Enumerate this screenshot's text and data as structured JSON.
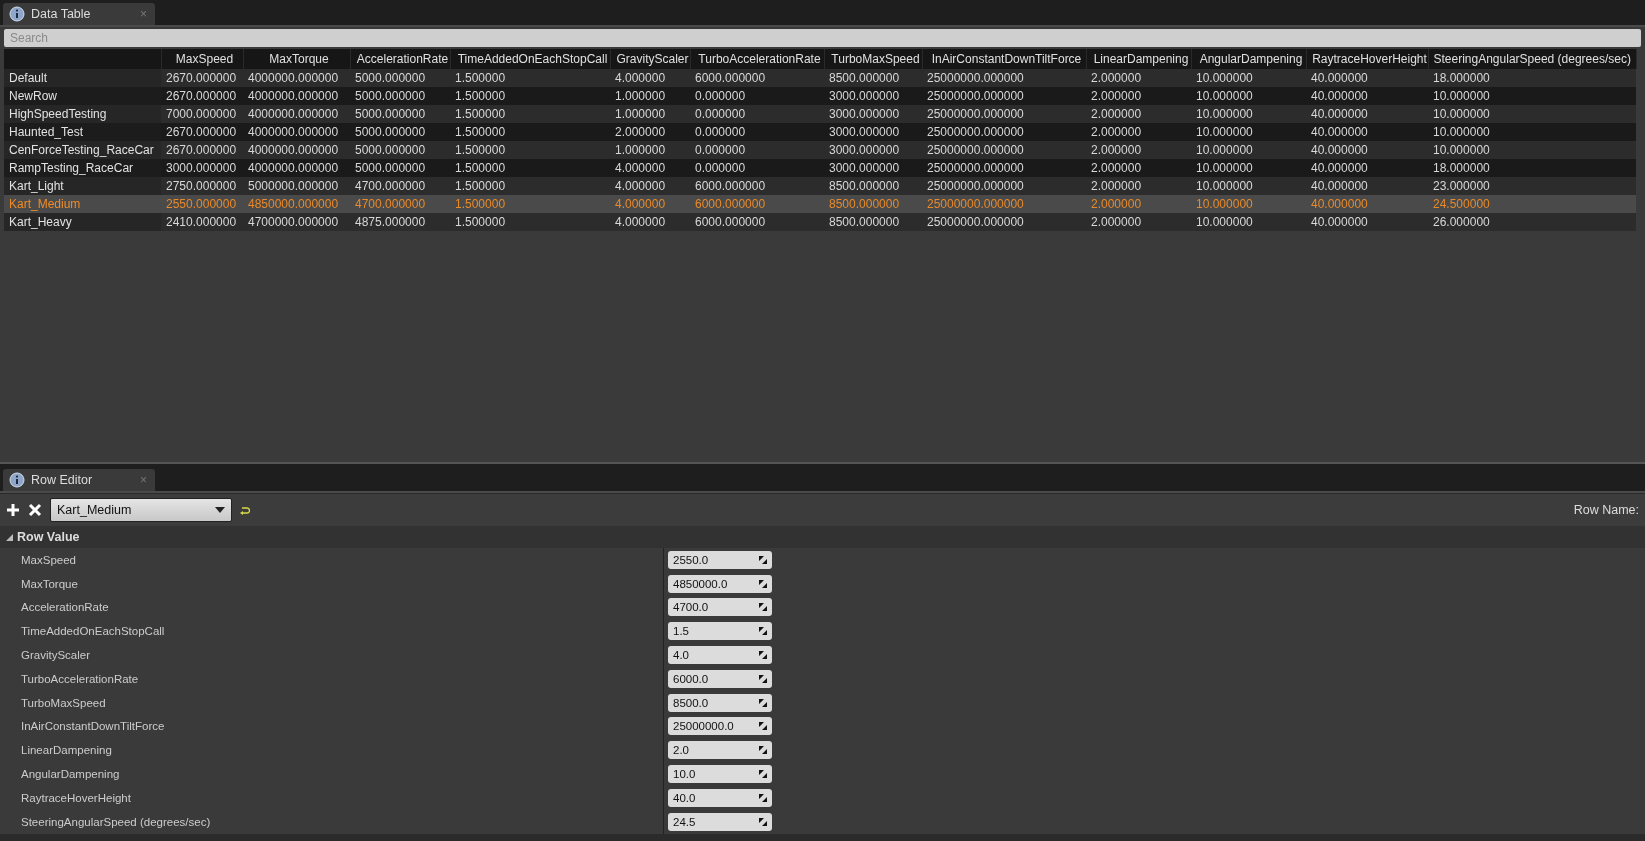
{
  "data_table_tab": {
    "title": "Data Table",
    "close": "×"
  },
  "search": {
    "placeholder": "Search"
  },
  "table": {
    "columns": [
      "MaxSpeed",
      "MaxTorque",
      "AccelerationRate",
      "TimeAddedOnEachStopCall",
      "GravityScaler",
      "TurboAccelerationRate",
      "TurboMaxSpeed",
      "InAirConstantDownTiltForce",
      "LinearDampening",
      "AngularDampening",
      "RaytraceHoverHeight",
      "SteeringAngularSpeed (degrees/sec)"
    ],
    "rows": [
      {
        "name": "Default",
        "selected": false,
        "cells": [
          "2670.000000",
          "4000000.000000",
          "5000.000000",
          "1.500000",
          "4.000000",
          "6000.000000",
          "8500.000000",
          "25000000.000000",
          "2.000000",
          "10.000000",
          "40.000000",
          "18.000000"
        ]
      },
      {
        "name": "NewRow",
        "selected": false,
        "cells": [
          "2670.000000",
          "4000000.000000",
          "5000.000000",
          "1.500000",
          "1.000000",
          "0.000000",
          "3000.000000",
          "25000000.000000",
          "2.000000",
          "10.000000",
          "40.000000",
          "10.000000"
        ]
      },
      {
        "name": "HighSpeedTesting",
        "selected": false,
        "cells": [
          "7000.000000",
          "4000000.000000",
          "5000.000000",
          "1.500000",
          "1.000000",
          "0.000000",
          "3000.000000",
          "25000000.000000",
          "2.000000",
          "10.000000",
          "40.000000",
          "10.000000"
        ]
      },
      {
        "name": "Haunted_Test",
        "selected": false,
        "cells": [
          "2670.000000",
          "4000000.000000",
          "5000.000000",
          "1.500000",
          "2.000000",
          "0.000000",
          "3000.000000",
          "25000000.000000",
          "2.000000",
          "10.000000",
          "40.000000",
          "10.000000"
        ]
      },
      {
        "name": "CenForceTesting_RaceCar",
        "selected": false,
        "cells": [
          "2670.000000",
          "4000000.000000",
          "5000.000000",
          "1.500000",
          "1.000000",
          "0.000000",
          "3000.000000",
          "25000000.000000",
          "2.000000",
          "10.000000",
          "40.000000",
          "10.000000"
        ]
      },
      {
        "name": "RampTesting_RaceCar",
        "selected": false,
        "cells": [
          "3000.000000",
          "4000000.000000",
          "5000.000000",
          "1.500000",
          "4.000000",
          "0.000000",
          "3000.000000",
          "25000000.000000",
          "2.000000",
          "10.000000",
          "40.000000",
          "18.000000"
        ]
      },
      {
        "name": "Kart_Light",
        "selected": false,
        "cells": [
          "2750.000000",
          "5000000.000000",
          "4700.000000",
          "1.500000",
          "4.000000",
          "6000.000000",
          "8500.000000",
          "25000000.000000",
          "2.000000",
          "10.000000",
          "40.000000",
          "23.000000"
        ]
      },
      {
        "name": "Kart_Medium",
        "selected": true,
        "cells": [
          "2550.000000",
          "4850000.000000",
          "4700.000000",
          "1.500000",
          "4.000000",
          "6000.000000",
          "8500.000000",
          "25000000.000000",
          "2.000000",
          "10.000000",
          "40.000000",
          "24.500000"
        ]
      },
      {
        "name": "Kart_Heavy",
        "selected": false,
        "cells": [
          "2410.000000",
          "4700000.000000",
          "4875.000000",
          "1.500000",
          "4.000000",
          "6000.000000",
          "8500.000000",
          "25000000.000000",
          "2.000000",
          "10.000000",
          "40.000000",
          "26.000000"
        ]
      }
    ]
  },
  "row_editor_tab": {
    "title": "Row Editor",
    "close": "×"
  },
  "toolbar": {
    "row_dropdown": "Kart_Medium",
    "row_name_label": "Row Name:"
  },
  "section": {
    "title": "Row Value",
    "expanded": true,
    "properties": [
      {
        "name": "MaxSpeed",
        "value": "2550.0"
      },
      {
        "name": "MaxTorque",
        "value": "4850000.0"
      },
      {
        "name": "AccelerationRate",
        "value": "4700.0"
      },
      {
        "name": "TimeAddedOnEachStopCall",
        "value": "1.5"
      },
      {
        "name": "GravityScaler",
        "value": "4.0"
      },
      {
        "name": "TurboAccelerationRate",
        "value": "6000.0"
      },
      {
        "name": "TurboMaxSpeed",
        "value": "8500.0"
      },
      {
        "name": "InAirConstantDownTiltForce",
        "value": "25000000.0"
      },
      {
        "name": "LinearDampening",
        "value": "2.0"
      },
      {
        "name": "AngularDampening",
        "value": "10.0"
      },
      {
        "name": "RaytraceHoverHeight",
        "value": "40.0"
      },
      {
        "name": "SteeringAngularSpeed (degrees/sec)",
        "value": "24.5"
      }
    ]
  }
}
